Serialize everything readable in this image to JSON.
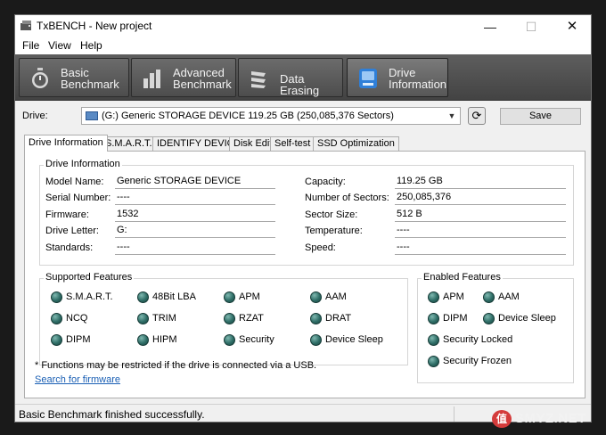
{
  "window": {
    "title": "TxBENCH - New project",
    "min": "—",
    "max": "☐",
    "close": "✕"
  },
  "menu": [
    "File",
    "View",
    "Help"
  ],
  "toolbar": {
    "buttons": [
      {
        "line1": "Basic",
        "line2": "Benchmark",
        "icon": "stopwatch-icon"
      },
      {
        "line1": "Advanced",
        "line2": "Benchmark",
        "icon": "bar-chart-icon"
      },
      {
        "line1": "Data Erasing",
        "line2": "",
        "icon": "eraser-icon"
      },
      {
        "line1": "Drive",
        "line2": "Information",
        "icon": "drive-info-icon"
      }
    ],
    "active_index": 3
  },
  "drive": {
    "label": "Drive:",
    "selected": "(G:) Generic STORAGE DEVICE  119.25 GB (250,085,376 Sectors)",
    "save_label": "Save"
  },
  "tabs": [
    "Drive Information",
    "S.M.A.R.T.",
    "IDENTIFY DEVICE",
    "Disk Edit",
    "Self-test",
    "SSD Optimization"
  ],
  "active_tab": 0,
  "info": {
    "group_title": "Drive Information",
    "left": [
      {
        "label": "Model Name:",
        "value": "Generic STORAGE DEVICE"
      },
      {
        "label": "Serial Number:",
        "value": "----"
      },
      {
        "label": "Firmware:",
        "value": "1532"
      },
      {
        "label": "Drive Letter:",
        "value": "G:"
      },
      {
        "label": "Standards:",
        "value": "----"
      }
    ],
    "right": [
      {
        "label": "Capacity:",
        "value": "119.25 GB"
      },
      {
        "label": "Number of Sectors:",
        "value": "250,085,376"
      },
      {
        "label": "Sector Size:",
        "value": "512 B"
      },
      {
        "label": "Temperature:",
        "value": "----"
      },
      {
        "label": "Speed:",
        "value": "----"
      }
    ]
  },
  "supported": {
    "group_title": "Supported Features",
    "items": [
      "S.M.A.R.T.",
      "48Bit LBA",
      "APM",
      "AAM",
      "NCQ",
      "TRIM",
      "RZAT",
      "DRAT",
      "DIPM",
      "HIPM",
      "Security",
      "Device Sleep"
    ]
  },
  "enabled": {
    "group_title": "Enabled Features",
    "items": [
      "APM",
      "AAM",
      "DIPM",
      "Device Sleep",
      "Security Locked",
      "Security Frozen"
    ]
  },
  "note": "* Functions may be restricted if the drive is connected via a USB.",
  "link": "Search for firmware",
  "status": "Basic Benchmark finished successfully.",
  "watermark": {
    "badge": "值",
    "text": "SMYZ.NET"
  },
  "colors": {
    "toolbar": "#4d4d4d",
    "led": "#2e6d66",
    "link": "#1a5fb4"
  }
}
